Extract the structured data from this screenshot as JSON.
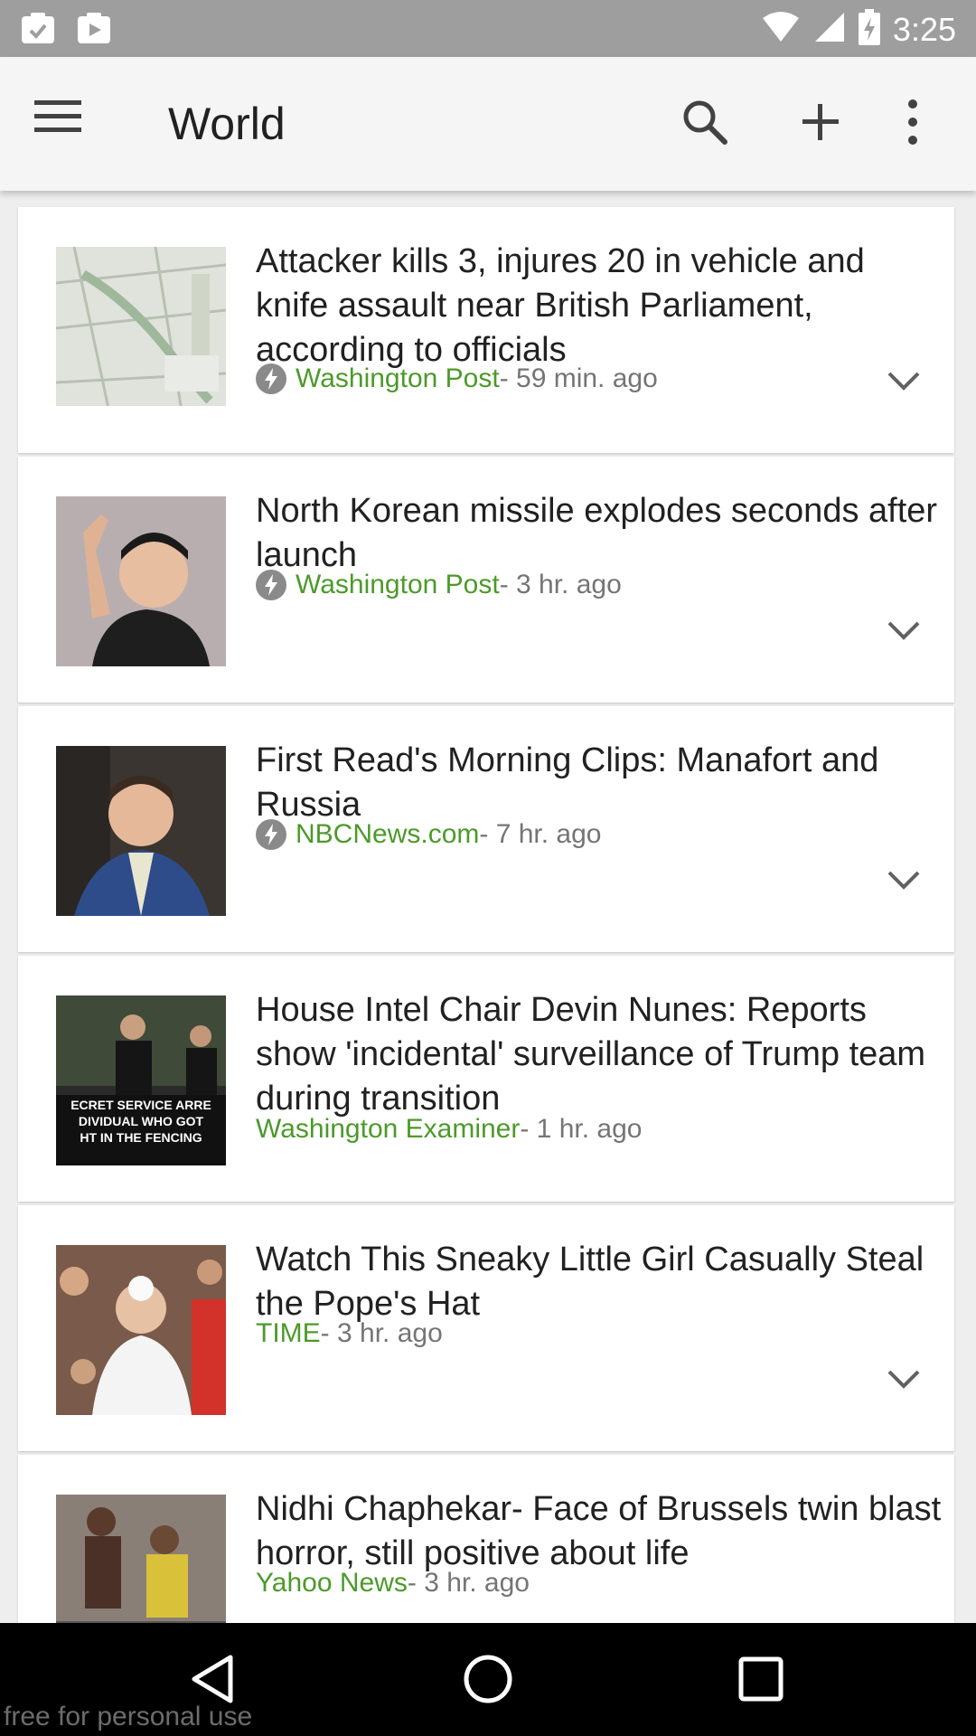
{
  "status_bar": {
    "time": "3:25",
    "left_icons": [
      "screenshot-notification-icon",
      "play-store-notification-icon"
    ],
    "right_icons": [
      "wifi-icon",
      "cell-signal-icon",
      "battery-charging-icon"
    ],
    "background": "#9e9e9e"
  },
  "app_bar": {
    "title": "World",
    "icons": {
      "menu": "hamburger-menu-icon",
      "search": "search-icon",
      "add": "add-icon",
      "more": "more-vert-icon"
    }
  },
  "articles": [
    {
      "headline": "Attacker kills 3, injures 20 in vehicle and knife assault near British Parliament, according to officials",
      "source": "Washington Post",
      "time": " - 59 min. ago",
      "amp": true,
      "thumbnail": "map-of-parliament-thumbnail"
    },
    {
      "headline": "North Korean missile explodes seconds after launch",
      "source": "Washington Post",
      "time": " - 3 hr. ago",
      "amp": true,
      "thumbnail": "kim-jong-un-waving-thumbnail"
    },
    {
      "headline": "First Read's Morning Clips: Manafort and Russia",
      "source": "NBCNews.com",
      "time": " - 7 hr. ago",
      "amp": true,
      "thumbnail": "paul-manafort-thumbnail"
    },
    {
      "headline": "House Intel Chair Devin Nunes: Reports show 'incidental' surveillance of Trump team during transition",
      "source": "Washington Examiner",
      "time": " - 1 hr. ago",
      "amp": false,
      "thumbnail": "secret-service-thumbnail",
      "thumbnail_text": [
        "ECRET SERVICE ARRE",
        "DIVIDUAL WHO GOT",
        "HT IN THE FENCING"
      ]
    },
    {
      "headline": "Watch This Sneaky Little Girl Casually Steal the Pope's Hat",
      "source": "TIME",
      "time": " - 3 hr. ago",
      "amp": false,
      "thumbnail": "pope-francis-thumbnail"
    },
    {
      "headline": "Nidhi Chaphekar- Face of Brussels twin blast horror, still positive about life",
      "source": "Yahoo News",
      "time": " - 3 hr. ago",
      "amp": false,
      "thumbnail": "brussels-blast-thumbnail"
    }
  ],
  "nav_bar": {
    "back": "back-icon",
    "home": "home-icon",
    "recents": "recents-icon"
  },
  "watermark": "free for personal use",
  "colors": {
    "source_green": "#4c9a2a",
    "app_bar_bg": "#f5f5f5",
    "card_bg": "#ffffff",
    "feed_bg": "#eeeeee"
  }
}
